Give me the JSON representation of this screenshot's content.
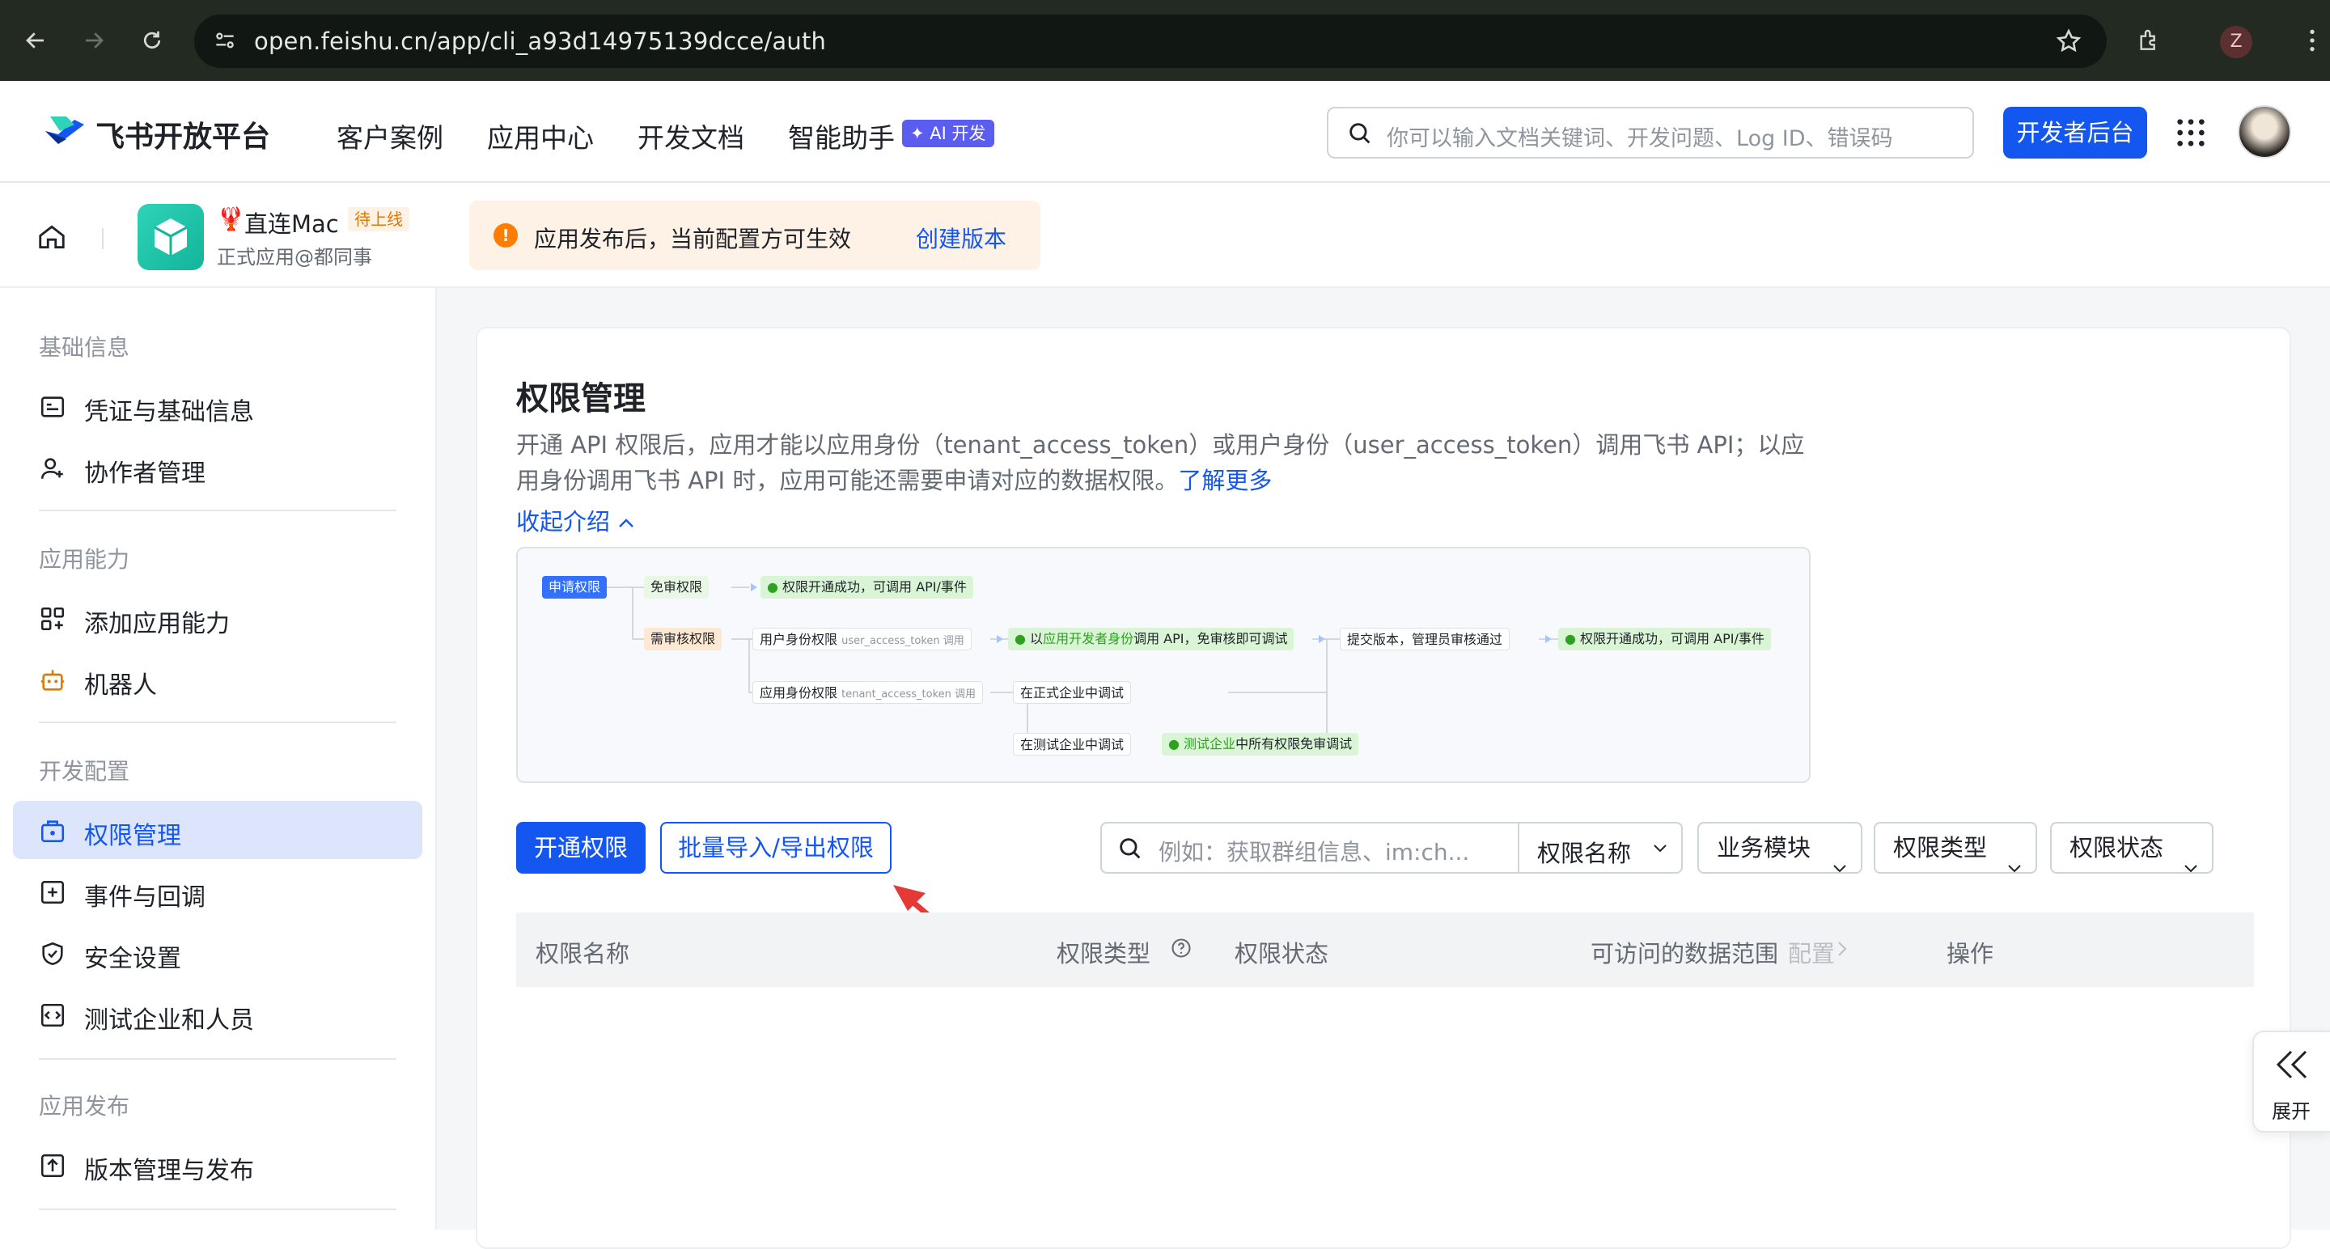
{
  "browser": {
    "url": "open.feishu.cn/app/cli_a93d14975139dcce/auth",
    "profile_initial": "Z"
  },
  "topnav": {
    "brand": "飞书开放平台",
    "links": [
      "客户案例",
      "应用中心",
      "开发文档",
      "智能助手"
    ],
    "ai_badge": "AI 开发",
    "search_placeholder": "你可以输入文档关键词、开发问题、Log ID、错误码",
    "dev_console": "开发者后台"
  },
  "appbar": {
    "app_emoji": "🦞",
    "app_name": "直连Mac",
    "app_status": "待上线",
    "app_sub": "正式应用@都同事",
    "notice_text": "应用发布后，当前配置方可生效",
    "notice_link": "创建版本"
  },
  "sidebar": {
    "sections": [
      {
        "title": "基础信息",
        "items": [
          "凭证与基础信息",
          "协作者管理"
        ]
      },
      {
        "title": "应用能力",
        "items": [
          "添加应用能力",
          "机器人"
        ]
      },
      {
        "title": "开发配置",
        "items": [
          "权限管理",
          "事件与回调",
          "安全设置",
          "测试企业和人员"
        ]
      },
      {
        "title": "应用发布",
        "items": [
          "版本管理与发布"
        ]
      }
    ],
    "active": "权限管理"
  },
  "main": {
    "title": "权限管理",
    "desc": "开通 API 权限后，应用才能以应用身份（tenant_access_token）或用户身份（user_access_token）调用飞书 API；以应用身份调用飞书 API 时，应用可能还需要申请对应的数据权限。",
    "learn_more": "了解更多",
    "collapse": "收起介绍",
    "diagram": {
      "apply": "申请权限",
      "free": "免审权限",
      "free_result": "权限开通成功，可调用 API/事件",
      "review": "需审核权限",
      "user_perm": "用户身份权限",
      "user_token": "user_access_token 调用",
      "dev_debug_pre": "以",
      "dev_debug_hl": "应用开发者身份",
      "dev_debug_post": "调用 API，免审核即可调试",
      "submit": "提交版本，管理员审核通过",
      "final_result": "权限开通成功，可调用 API/事件",
      "app_perm": "应用身份权限",
      "app_token": "tenant_access_token 调用",
      "prod_debug": "在正式企业中调试",
      "test_debug": "在测试企业中调试",
      "test_result_hl": "测试企业",
      "test_result_post": "中所有权限免审调试"
    },
    "btn_open": "开通权限",
    "btn_batch": "批量导入/导出权限",
    "filter_placeholder": "例如：获取群组信息、im:ch...",
    "filter_field": "权限名称",
    "filters": [
      "业务模块",
      "权限类型",
      "权限状态"
    ],
    "table_headers": {
      "name": "权限名称",
      "type": "权限类型",
      "status": "权限状态",
      "scope": "可访问的数据范围",
      "scope_config": "配置",
      "ops": "操作"
    },
    "expand": "展开"
  },
  "colors": {
    "primary": "#1456f0",
    "chrome_bg": "#232a22",
    "notice_bg": "#fef1e6",
    "active_bg": "#dce5fc"
  }
}
